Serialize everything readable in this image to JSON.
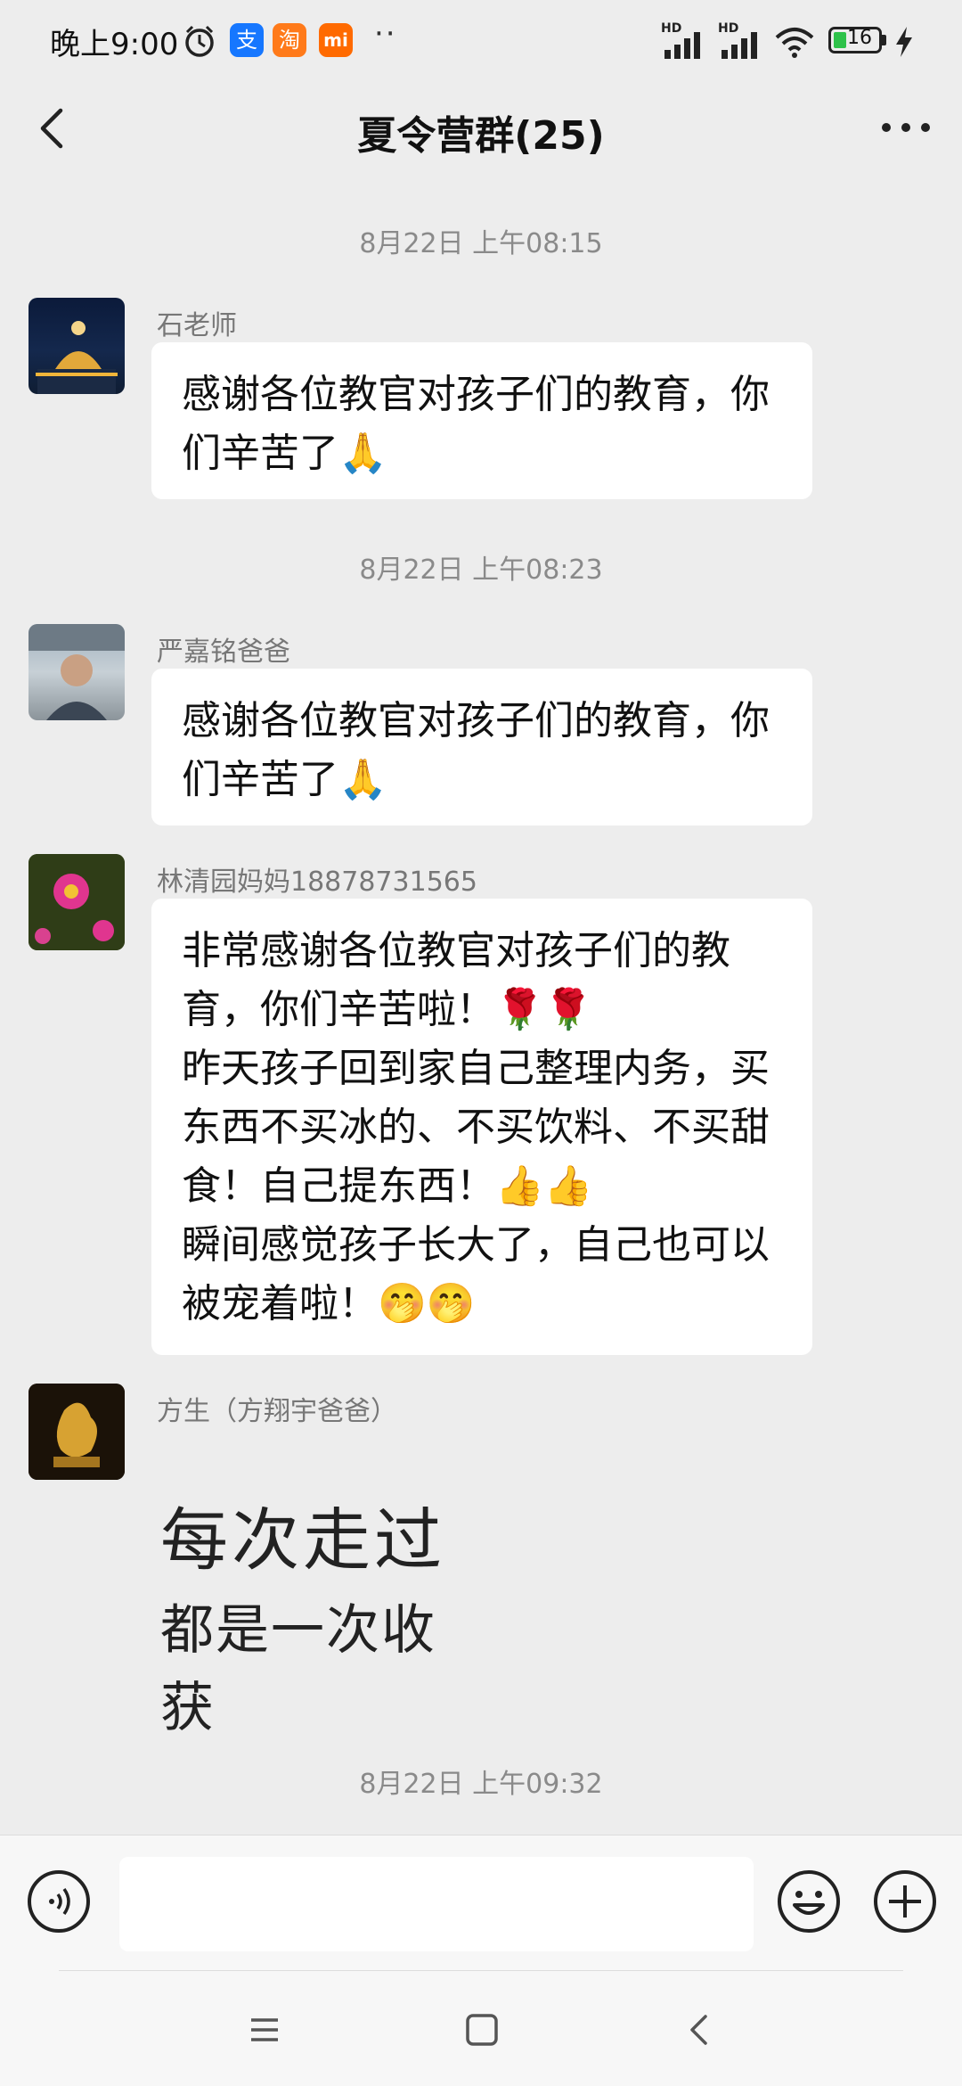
{
  "status_bar": {
    "time": "晚上9:00",
    "network_label": "HD",
    "battery_level": "16",
    "app_icons": [
      "alarm-icon",
      "alipay-icon",
      "taobao-icon",
      "xiaomi-icon"
    ],
    "alipay_glyph": "支",
    "taobao_glyph": "淘",
    "xiaomi_glyph": "mi",
    "more_glyph": "··"
  },
  "header": {
    "title": "夏令营群(25)"
  },
  "messages": [
    {
      "type": "timestamp",
      "text": "8月22日 上午08:15"
    },
    {
      "type": "message",
      "sender": "石老师",
      "text": "感谢各位教官对孩子们的教育，你\n们辛苦了🙏"
    },
    {
      "type": "timestamp",
      "text": "8月22日 上午08:23"
    },
    {
      "type": "message",
      "sender": "严嘉铭爸爸",
      "text": "感谢各位教官对孩子们的教育，你\n们辛苦了🙏"
    },
    {
      "type": "message",
      "sender": "林清园妈妈18878731565",
      "text": "非常感谢各位教官对孩子们的教\n育，你们辛苦啦！🌹🌹\n昨天孩子回到家自己整理内务，买\n东西不买冰的、不买饮料、不买甜\n食！自己提东西！👍👍\n瞬间感觉孩子长大了，自己也可以\n被宠着啦！🤭🤭"
    },
    {
      "type": "sticker",
      "sender": "方生（方翔宇爸爸）",
      "line1": "每次走过",
      "line2": "都是一次收获"
    },
    {
      "type": "timestamp",
      "text": "8月22日 上午09:32"
    }
  ],
  "input_bar": {
    "placeholder": "",
    "icons": [
      "voice-icon",
      "emoji-icon",
      "plus-icon"
    ]
  },
  "nav_bar": {
    "icons": [
      "menu-icon",
      "home-icon",
      "back-icon"
    ]
  },
  "colors": {
    "background": "#ededed",
    "bubble": "#ffffff",
    "battery_fill": "#2ec24a",
    "alipay": "#1677ff",
    "taobao": "#ff7a1a",
    "xiaomi": "#ff6a00"
  }
}
